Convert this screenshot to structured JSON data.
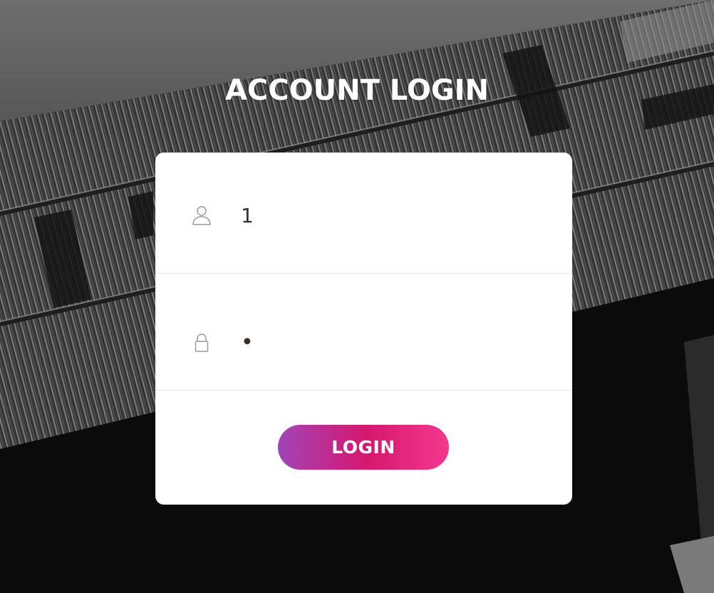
{
  "page": {
    "title": "ACCOUNT LOGIN"
  },
  "form": {
    "username": {
      "icon": "user-icon",
      "value": "1"
    },
    "password": {
      "icon": "lock-icon",
      "value": "1"
    },
    "submit_label": "LOGIN"
  },
  "colors": {
    "button_gradient_start": "#a044b8",
    "button_gradient_mid": "#d6186f",
    "button_gradient_end": "#f2388d",
    "card_background": "#ffffff",
    "icon_color": "#9a9a9a",
    "input_text": "#3a2e28"
  }
}
